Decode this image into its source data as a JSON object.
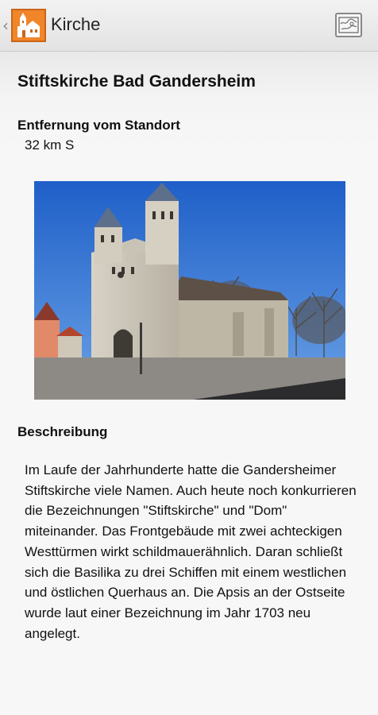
{
  "app_bar": {
    "back_glyph": "‹",
    "title": "Kirche",
    "app_icon": "church-icon",
    "map_button_icon": "map-icon"
  },
  "detail": {
    "name": "Stiftskirche Bad Gandersheim",
    "distance_label": "Entfernung vom Standort",
    "distance_value": "32 km S",
    "photo_icon": "church-photo",
    "description_label": "Beschreibung",
    "description_text": "Im Laufe der Jahrhunderte hatte die Gandersheimer Stiftskirche viele Namen. Auch heute noch konkurrieren die Bezeichnungen \"Stiftskirche\" und \"Dom\" miteinander. Das Frontgebäude mit zwei achteckigen Westtürmen wirkt schildmauerähnlich. Daran schließt sich die Basilika zu drei Schiffen mit einem westlichen und östlichen Querhaus an. Die Apsis an der Ostseite wurde laut einer Bezeichnung im Jahr 1703 neu angelegt."
  },
  "colors": {
    "accent": "#f0852a",
    "sky": "#2f6fd0"
  }
}
